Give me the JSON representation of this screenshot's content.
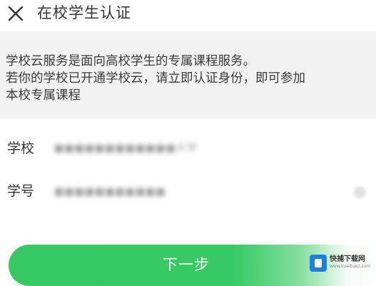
{
  "header": {
    "close_icon": "close-icon",
    "title": "在校学生认证"
  },
  "info": {
    "line1": "学校云服务是面向高校学生的专属课程服务。",
    "line2": "若你的学校已开通学校云，请立即认证身份，即可参加",
    "line3": "本校专属课程"
  },
  "form": {
    "school_label": "学校",
    "school_value": "■■■■■■■■■■■■大学",
    "student_id_label": "学号",
    "student_id_value": "■■■■■■■■■■■",
    "clear_icon": "clear-icon"
  },
  "actions": {
    "next_label": "下一步"
  },
  "watermark": {
    "title": "快捕下载网",
    "url": "www.kuaibuxz.com"
  },
  "colors": {
    "primary_green": "#37c864",
    "info_bg": "#f2f2f2",
    "text": "#333333"
  }
}
